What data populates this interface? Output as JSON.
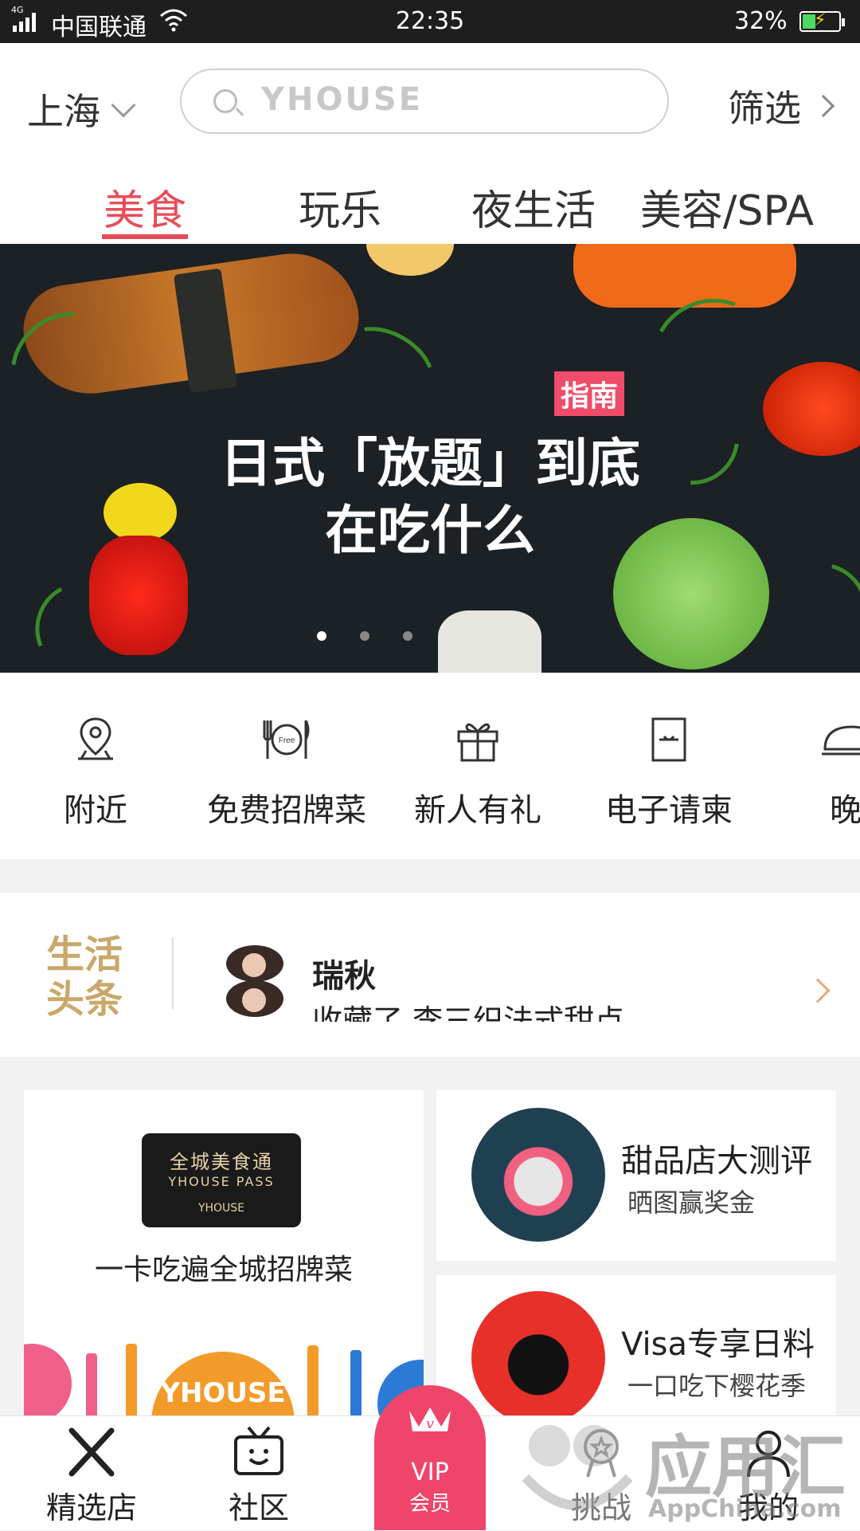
{
  "status_bar": {
    "network": "4G",
    "carrier": "中国联通",
    "time": "22:35",
    "battery": "32%"
  },
  "header": {
    "city": "上海",
    "search_placeholder": "YHOUSE",
    "filter_label": "筛选",
    "tabs": [
      {
        "label": "美食",
        "active": true
      },
      {
        "label": "玩乐",
        "active": false
      },
      {
        "label": "夜生活",
        "active": false
      },
      {
        "label": "美容/SPA",
        "active": false
      }
    ]
  },
  "banner": {
    "tag": "指南",
    "title_line1": "日式「放题」到底",
    "title_line2": "在吃什么",
    "page_count": 3,
    "active_page": 1
  },
  "quick_menu": [
    {
      "label": "附近",
      "icon": "location-pin-icon"
    },
    {
      "label": "免费招牌菜",
      "icon": "free-dish-icon"
    },
    {
      "label": "新人有礼",
      "icon": "gift-icon"
    },
    {
      "label": "电子请柬",
      "icon": "invitation-icon"
    },
    {
      "label": "晚",
      "icon": "cloche-icon"
    }
  ],
  "headline": {
    "logo_line1": "生活",
    "logo_line2": "头条",
    "author": "瑞秋",
    "snippet": "收藏了 李三织法式甜点"
  },
  "cards": {
    "pass": {
      "image_line1": "全城美食通",
      "image_line2": "YHOUSE PASS",
      "image_line3": "YHOUSE",
      "title": "一卡吃遍全城招牌菜",
      "illustration_text": "YHOUSE"
    },
    "dessert": {
      "title": "甜品店大测评",
      "subtitle": "晒图赢奖金"
    },
    "visa": {
      "title": "Visa专享日料",
      "subtitle": "一口吃下樱花季"
    }
  },
  "bottom_nav": [
    {
      "label": "精选店",
      "icon": "fork-knife-icon"
    },
    {
      "label": "社区",
      "icon": "tv-smile-icon"
    },
    {
      "label": "挑战",
      "icon": "medal-icon"
    },
    {
      "label": "我的",
      "icon": "profile-icon"
    }
  ],
  "vip": {
    "label": "VIP",
    "sub": "会员"
  },
  "watermark": {
    "line1": "应用汇",
    "line2": "AppChina.com"
  },
  "colors": {
    "accent": "#e94b58",
    "vip": "#f0456a",
    "headline_gold": "#c9a86a"
  }
}
